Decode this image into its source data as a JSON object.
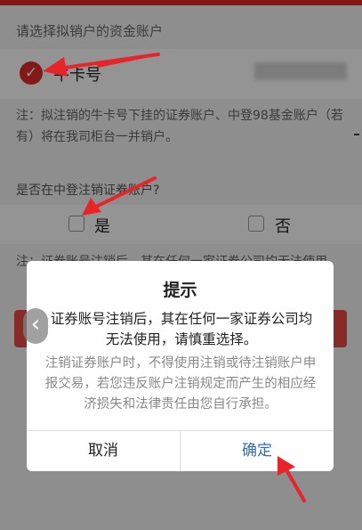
{
  "colors": {
    "accent_red": "#e02b2b",
    "dialog_ok": "#2b6fb8",
    "annotation_arrow": "#e8242b"
  },
  "account_section": {
    "title": "请选择拟销户的资金账户",
    "account_label": "牛卡号",
    "note": "注：拟注销的牛卡号下挂的证券账户、中登98基金账户（若有）将在我司柜台一并销户。"
  },
  "cancel_question": {
    "title": "是否在中登注销证券账户?",
    "option_yes": "是",
    "option_no": "否",
    "note": "注：证券账号注销后，其在任何一家证券公司均无法使用"
  },
  "dialog": {
    "title": "提示",
    "main_message": "证券账号注销后，其在任何一家证券公司均无法使用，请慎重选择。",
    "sub_message": "注销证券账户时，不得使用注销或待注销账户申报交易，若您违反账户注销规定而产生的相应经济损失和法律责任由您自行承担。",
    "cancel_label": "取消",
    "confirm_label": "确定"
  },
  "icons": {
    "back": "chevron-left-icon",
    "check": "checkmark-icon"
  }
}
